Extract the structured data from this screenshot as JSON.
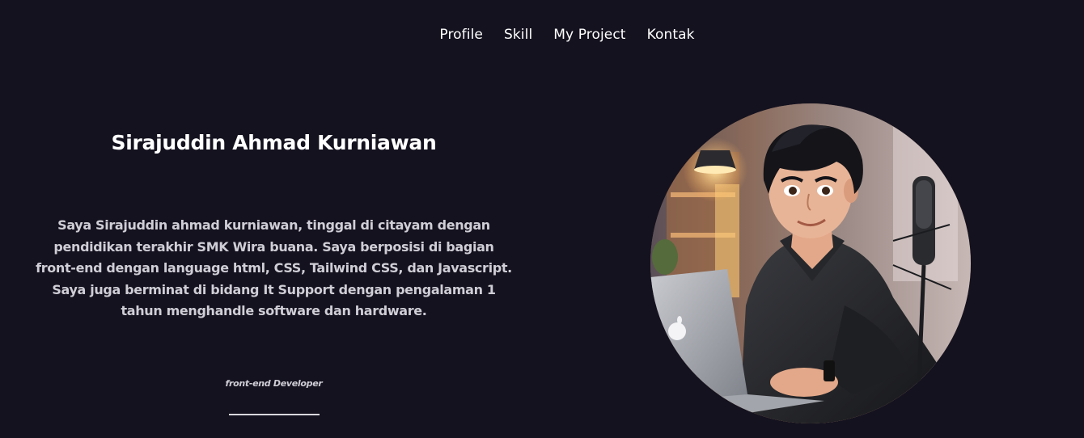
{
  "nav": {
    "items": [
      {
        "label": "Profile"
      },
      {
        "label": "Skill"
      },
      {
        "label": "My Project"
      },
      {
        "label": "Kontak"
      }
    ]
  },
  "hero": {
    "name": "Sirajuddin Ahmad Kurniawan",
    "bio": "Saya Sirajuddin ahmad kurniawan, tinggal di citayam dengan pendidikan terakhir SMK Wira buana. Saya berposisi di bagian front-end dengan language html, CSS, Tailwind CSS, dan Javascript. Saya juga berminat di bidang It Support dengan pengalaman 1 tahun menghandle software dan hardware.",
    "role": "front-end Developer"
  },
  "colors": {
    "background": "#15121f",
    "text": "#ffffff",
    "muted_text": "#cfcdd5"
  }
}
